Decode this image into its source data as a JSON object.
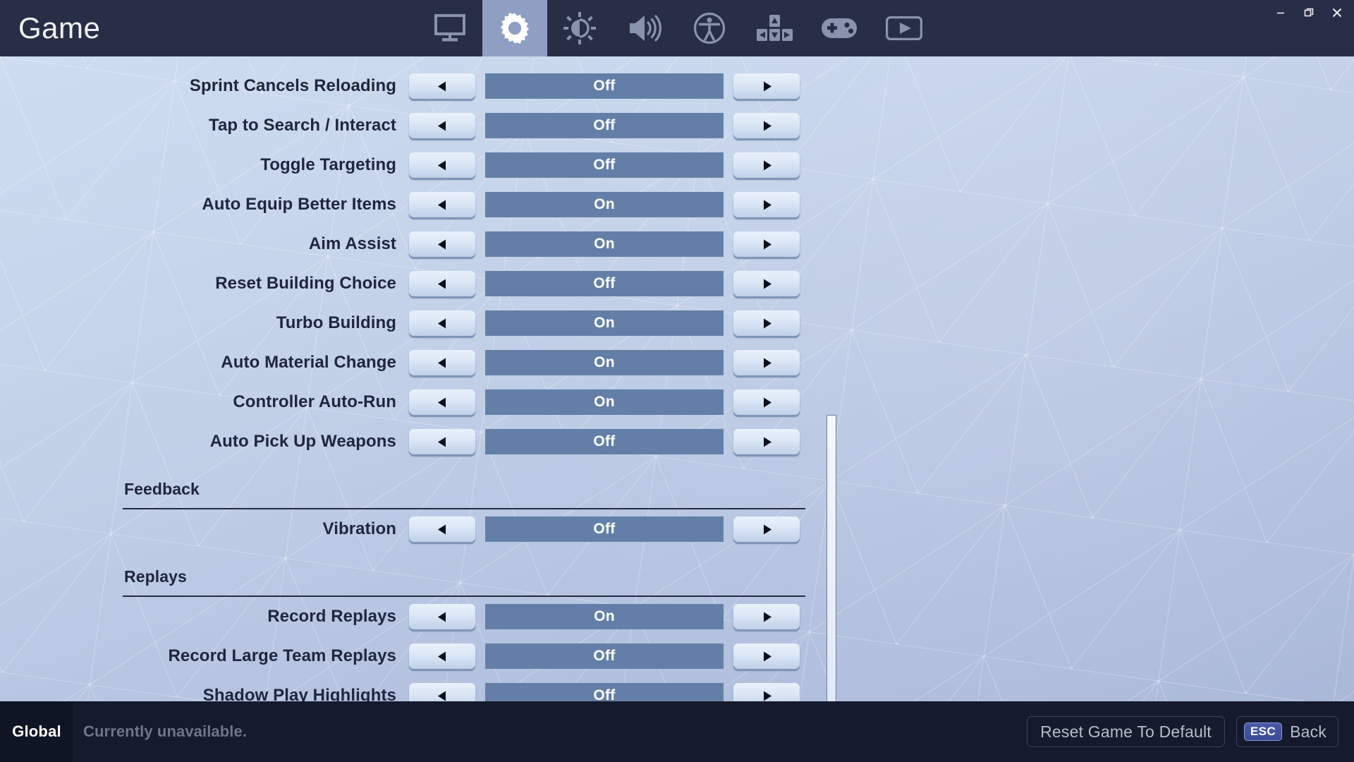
{
  "window": {
    "title": "Game",
    "controls": [
      {
        "name": "minimize",
        "glyph": "minimize-icon"
      },
      {
        "name": "restore",
        "glyph": "restore-icon"
      },
      {
        "name": "close",
        "glyph": "close-icon"
      }
    ]
  },
  "tabs": [
    {
      "id": "video",
      "icon": "monitor-icon",
      "active": false
    },
    {
      "id": "game",
      "icon": "gear-icon",
      "active": true
    },
    {
      "id": "brightness",
      "icon": "brightness-icon",
      "active": false
    },
    {
      "id": "audio",
      "icon": "speaker-icon",
      "active": false
    },
    {
      "id": "accessibility",
      "icon": "accessibility-icon",
      "active": false
    },
    {
      "id": "keybinds",
      "icon": "arrow-keys-icon",
      "active": false
    },
    {
      "id": "controller",
      "icon": "gamepad-icon",
      "active": false
    },
    {
      "id": "replay",
      "icon": "play-screen-icon",
      "active": false
    }
  ],
  "settings": [
    {
      "type": "row",
      "label": "Sprint Cancels Reloading",
      "value": "Off"
    },
    {
      "type": "row",
      "label": "Tap to Search / Interact",
      "value": "Off"
    },
    {
      "type": "row",
      "label": "Toggle Targeting",
      "value": "Off"
    },
    {
      "type": "row",
      "label": "Auto Equip Better Items",
      "value": "On"
    },
    {
      "type": "row",
      "label": "Aim Assist",
      "value": "On"
    },
    {
      "type": "row",
      "label": "Reset Building Choice",
      "value": "Off"
    },
    {
      "type": "row",
      "label": "Turbo Building",
      "value": "On"
    },
    {
      "type": "row",
      "label": "Auto Material Change",
      "value": "On"
    },
    {
      "type": "row",
      "label": "Controller Auto-Run",
      "value": "On"
    },
    {
      "type": "row",
      "label": "Auto Pick Up Weapons",
      "value": "Off"
    },
    {
      "type": "section",
      "label": "Feedback"
    },
    {
      "type": "row",
      "label": "Vibration",
      "value": "Off"
    },
    {
      "type": "section",
      "label": "Replays"
    },
    {
      "type": "row",
      "label": "Record Replays",
      "value": "On"
    },
    {
      "type": "row",
      "label": "Record Large Team Replays",
      "value": "Off"
    },
    {
      "type": "row",
      "label": "Shadow Play Highlights",
      "value": "Off"
    }
  ],
  "controls": {
    "prev_icon": "left-arrow-icon",
    "next_icon": "right-arrow-icon"
  },
  "footer": {
    "scope_label": "Global",
    "status_text": "Currently unavailable.",
    "reset_label": "Reset Game To Default",
    "back_key": "ESC",
    "back_label": "Back"
  },
  "colors": {
    "titlebar_bg": "#282e45",
    "tab_active_bg": "#8f9fc4",
    "value_bar": "#637fa8",
    "footer_bg": "#151a2c",
    "label_text": "#20263d",
    "esc_badge": "#3f4f9e"
  }
}
